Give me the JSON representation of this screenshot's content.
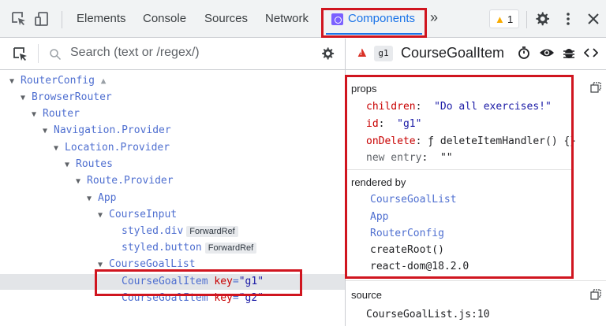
{
  "toolbar": {
    "tabs": [
      {
        "label": "Elements"
      },
      {
        "label": "Console"
      },
      {
        "label": "Sources"
      },
      {
        "label": "Network"
      },
      {
        "label": "Components"
      }
    ],
    "more_tabs": "»",
    "warning_count": "1",
    "colors": {
      "highlight": "#d0151f",
      "accent": "#1a73e8",
      "components_icon": "#7b61ff"
    }
  },
  "left": {
    "search_placeholder": "Search (text or /regex/)",
    "tree": [
      {
        "label": "RouterConfig",
        "expanded": true
      },
      {
        "label": "BrowserRouter",
        "expanded": true
      },
      {
        "label": "Router",
        "expanded": true
      },
      {
        "label": "Navigation.Provider",
        "expanded": true
      },
      {
        "label": "Location.Provider",
        "expanded": true
      },
      {
        "label": "Routes",
        "expanded": true
      },
      {
        "label": "Route.Provider",
        "expanded": true
      },
      {
        "label": "App",
        "expanded": true
      },
      {
        "label": "CourseInput",
        "expanded": true
      },
      {
        "label": "styled.div",
        "hoc": "ForwardRef"
      },
      {
        "label": "styled.button",
        "hoc": "ForwardRef"
      },
      {
        "label": "CourseGoalList",
        "expanded": true
      },
      {
        "label": "CourseGoalItem",
        "key_attr": "key",
        "key_value": "\"g1\"",
        "selected": true
      },
      {
        "label": "CourseGoalItem",
        "key_attr": "key",
        "key_value": "\"g2\""
      }
    ]
  },
  "right": {
    "key_badge": "g1",
    "title": "CourseGoalItem",
    "props_label": "props",
    "props": [
      {
        "key": "children",
        "value": "\"Do all exercises!\"",
        "kind": "string"
      },
      {
        "key": "id",
        "value": "\"g1\"",
        "kind": "string"
      },
      {
        "key": "onDelete",
        "value": "ƒ deleteItemHandler() {}",
        "kind": "function"
      },
      {
        "key": "new entry",
        "value": "\"\"",
        "kind": "new"
      }
    ],
    "rendered_by_label": "rendered by",
    "rendered_by": [
      {
        "label": "CourseGoalList",
        "link": true
      },
      {
        "label": "App",
        "link": true
      },
      {
        "label": "RouterConfig",
        "link": true
      },
      {
        "label": "createRoot()",
        "link": false
      },
      {
        "label": "react-dom@18.2.0",
        "link": false
      }
    ],
    "source_label": "source",
    "source_value": "CourseGoalList.js:10"
  }
}
